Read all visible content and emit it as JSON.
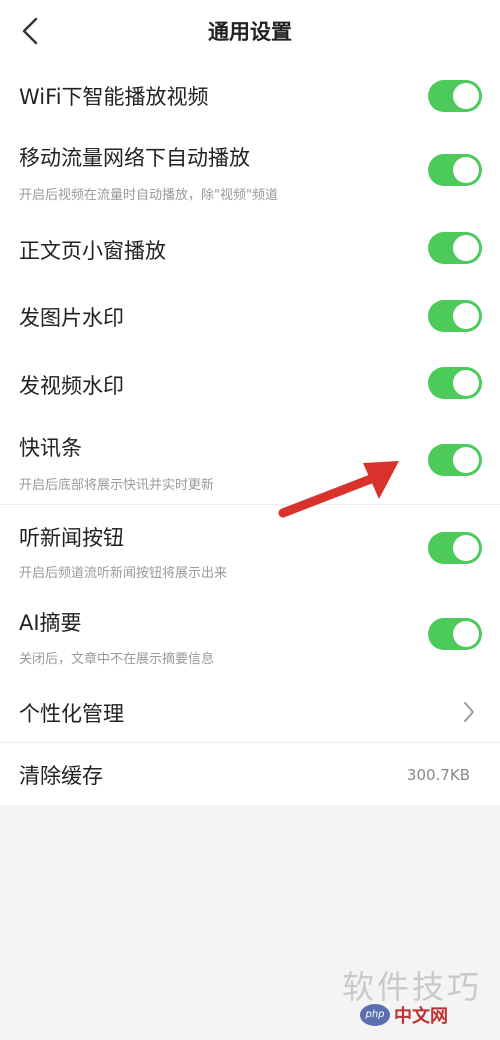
{
  "header": {
    "title": "通用设置"
  },
  "settings": [
    {
      "label": "WiFi下智能播放视频",
      "on": true
    },
    {
      "label": "移动流量网络下自动播放",
      "sub": "开启后视频在流量时自动播放，除\"视频\"频道",
      "on": true
    },
    {
      "label": "正文页小窗播放",
      "on": true
    },
    {
      "label": "发图片水印",
      "on": true
    },
    {
      "label": "发视频水印",
      "on": true
    },
    {
      "label": "快讯条",
      "sub": "开启后底部将展示快讯并实时更新",
      "on": true
    },
    {
      "label": "听新闻按钮",
      "sub": "开启后频道流听新闻按钮将展示出来",
      "on": true
    },
    {
      "label": "AI摘要",
      "sub": "关闭后，文章中不在展示摘要信息",
      "on": true
    }
  ],
  "personalize": {
    "label": "个性化管理"
  },
  "cache": {
    "label": "清除缓存",
    "value": "300.7KB"
  },
  "watermark": {
    "text": "软件技巧",
    "badge": "php",
    "site": "中文网"
  },
  "colors": {
    "toggle_on": "#4cca5a",
    "arrow": "#d9322c"
  }
}
